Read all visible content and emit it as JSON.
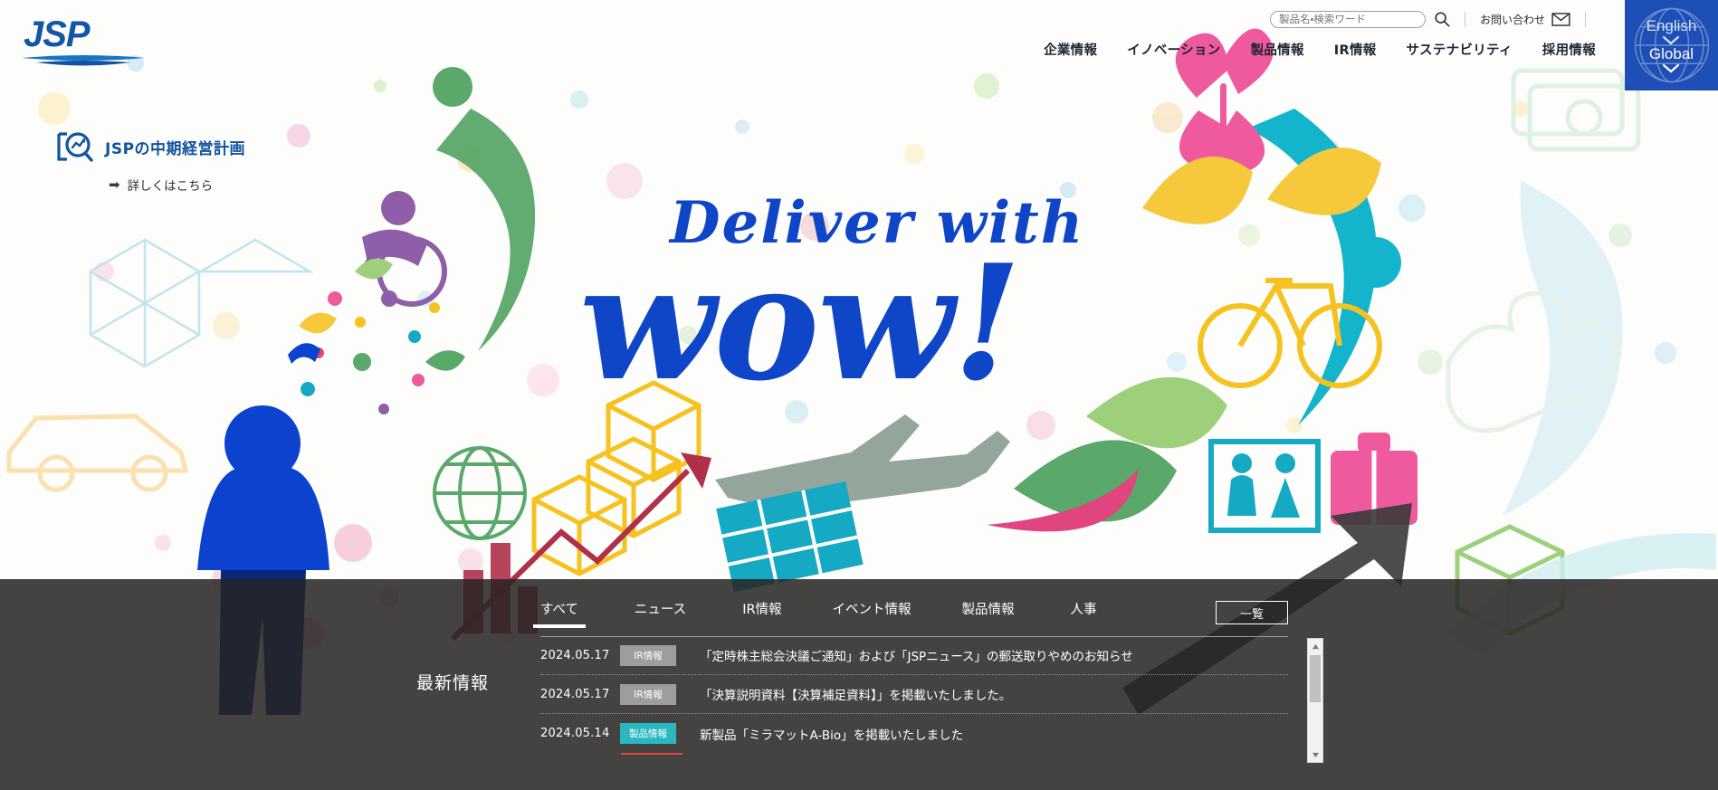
{
  "brand": {
    "logo_text": "JSP",
    "primary_blue": "#1256a8",
    "headline_blue": "#0f46c8",
    "lang_blue": "#1e4fb6",
    "badge_ir": "#9d9d9d",
    "badge_product": "#2ab8c0",
    "news_scrim": "#262423"
  },
  "header": {
    "search": {
      "placeholder": "製品名・検索ワード",
      "value": "",
      "icon": "search-icon"
    },
    "contact": {
      "label": "お問い合わせ",
      "icon": "mail-icon"
    },
    "nav": [
      {
        "label": "企業情報"
      },
      {
        "label": "イノベーション"
      },
      {
        "label": "製品情報"
      },
      {
        "label": "IR情報"
      },
      {
        "label": "サステナビリティ"
      },
      {
        "label": "採用情報"
      }
    ],
    "language": {
      "top": "English",
      "bottom": "Global",
      "icon": "globe-icon",
      "chevron": "chevron-down-icon"
    }
  },
  "plan_banner": {
    "icon": "chart-search-icon",
    "title": "JSPの中期経営計画",
    "link_arrow": "➡",
    "link_label": "詳しくはこちら"
  },
  "hero": {
    "headline_line1": "Deliver with",
    "headline_line2": "wow!"
  },
  "news": {
    "section_label": "最新情報",
    "tabs": [
      {
        "label": "すべて",
        "active": true
      },
      {
        "label": "ニュース",
        "active": false
      },
      {
        "label": "IR情報",
        "active": false
      },
      {
        "label": "イベント情報",
        "active": false
      },
      {
        "label": "製品情報",
        "active": false
      },
      {
        "label": "人事",
        "active": false
      }
    ],
    "list_button": "一覧",
    "items": [
      {
        "date": "2024.05.17",
        "category": "IR情報",
        "category_color": "#9d9d9d",
        "title": "「定時株主総会決議ご通知」および「JSPニュース」の郵送取りやめのお知らせ"
      },
      {
        "date": "2024.05.17",
        "category": "IR情報",
        "category_color": "#9d9d9d",
        "title": "「決算説明資料【決算補足資料】」を掲載いたしました。"
      },
      {
        "date": "2024.05.14",
        "category": "製品情報",
        "category_color": "#2ab8c0",
        "title": "新製品「ミラマットA-Bio」を掲載いたしました"
      }
    ],
    "scrollbar": {
      "up_arrow": "▲",
      "down_arrow": "▼"
    }
  }
}
